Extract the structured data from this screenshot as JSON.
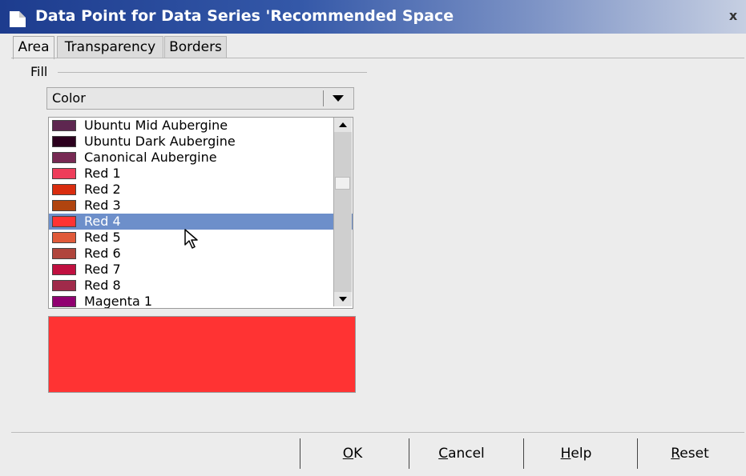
{
  "window": {
    "title": "Data Point for Data Series 'Recommended Space",
    "close_label": "x"
  },
  "tabs": [
    {
      "label": "Area",
      "active": true
    },
    {
      "label": "Transparency",
      "active": false
    },
    {
      "label": "Borders",
      "active": false
    }
  ],
  "fill": {
    "label": "Fill",
    "select_value": "Color"
  },
  "color_list": {
    "items": [
      {
        "label": "Ubuntu Mid Aubergine",
        "color": "#5e2750"
      },
      {
        "label": "Ubuntu Dark Aubergine",
        "color": "#2c001e"
      },
      {
        "label": "Canonical Aubergine",
        "color": "#772953"
      },
      {
        "label": "Red 1",
        "color": "#ee3d5a"
      },
      {
        "label": "Red 2",
        "color": "#d92d0f"
      },
      {
        "label": "Red 3",
        "color": "#b0440f"
      },
      {
        "label": "Red 4",
        "color": "#ff3333",
        "selected": true
      },
      {
        "label": "Red 5",
        "color": "#e05a3a"
      },
      {
        "label": "Red 6",
        "color": "#b0453c"
      },
      {
        "label": "Red 7",
        "color": "#c01040"
      },
      {
        "label": "Red 8",
        "color": "#a02a4a"
      },
      {
        "label": "Magenta 1",
        "color": "#900070"
      }
    ]
  },
  "preview": {
    "color": "#ff3333"
  },
  "buttons": {
    "ok": {
      "mnemonic": "O",
      "rest": "K"
    },
    "cancel": {
      "mnemonic": "C",
      "rest": "ancel"
    },
    "help": {
      "mnemonic": "H",
      "rest": "elp"
    },
    "reset": {
      "mnemonic": "R",
      "rest": "eset"
    }
  }
}
